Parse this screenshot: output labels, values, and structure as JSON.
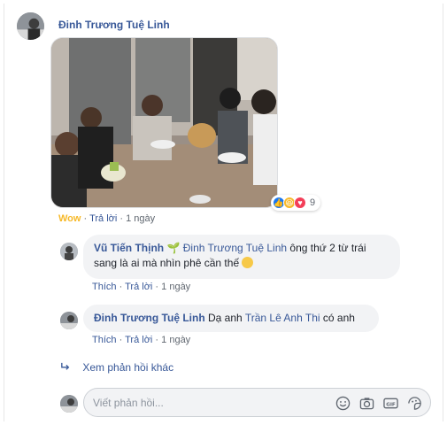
{
  "post": {
    "author": "Đinh Trương Tuệ Linh",
    "reaction_count": "9",
    "wow_label": "Wow",
    "reply_label": "Trả lời",
    "time": "1 ngày"
  },
  "replies": [
    {
      "author": "Vũ Tiến Thịnh",
      "tagged": "Đinh Trương Tuệ Linh",
      "text_line1": "ông thứ 2 từ trái",
      "text_line2": "sang là ai mà nhìn phê cần thế",
      "like_label": "Thích",
      "reply_label": "Trả lời",
      "time": "1 ngày"
    },
    {
      "author": "Đinh Trương Tuệ Linh",
      "text_before": "Dạ anh",
      "tagged": "Trần Lê Anh Thi",
      "text_after": "có anh",
      "like_label": "Thích",
      "reply_label": "Trả lời",
      "time": "1 ngày"
    }
  ],
  "more_replies": "Xem phản hồi khác",
  "reply_input": {
    "placeholder": "Viết phản hồi..."
  },
  "dot": "·",
  "icons": [
    "reply-arrow-icon",
    "emoji-icon",
    "camera-icon",
    "gif-icon",
    "sticker-icon"
  ],
  "colors": {
    "link": "#385898",
    "wow": "#f7b928",
    "like": "#1877f2",
    "love": "#f33e58",
    "bubble": "#f2f3f5"
  }
}
